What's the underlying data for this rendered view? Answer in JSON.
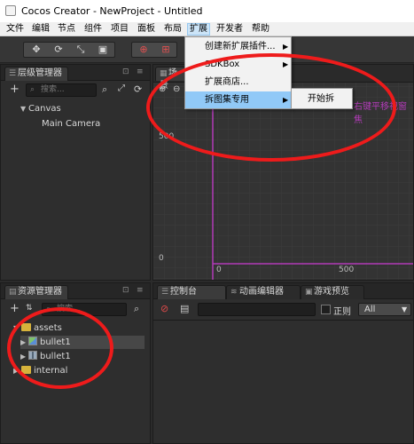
{
  "window": {
    "title": "Cocos Creator - NewProject - Untitled"
  },
  "menubar": {
    "items": [
      "文件",
      "编辑",
      "节点",
      "组件",
      "项目",
      "面板",
      "布局",
      "扩展",
      "开发者",
      "帮助"
    ],
    "active_index": 7
  },
  "toolbar": {
    "transform_tools": [
      "move-tool",
      "rotate-tool",
      "scale-tool",
      "rect-tool"
    ]
  },
  "hierarchy": {
    "tab_label": "层级管理器",
    "search_placeholder": "搜索...",
    "nodes": [
      {
        "label": "Canvas",
        "expanded": true,
        "depth": 0
      },
      {
        "label": "Main Camera",
        "depth": 1
      }
    ]
  },
  "scene": {
    "tab_label": "场景",
    "ruler": {
      "y_labels": [
        "500",
        "0"
      ],
      "x_labels": [
        "0",
        "500"
      ]
    },
    "hint_text": "右键平移视窗焦",
    "colors": {
      "canvas_border": "#b23bb8",
      "background": "#333333",
      "grid": "#3d3d3d"
    }
  },
  "extension_menu": {
    "items": [
      {
        "label": "创建新扩展插件...",
        "has_submenu": true
      },
      {
        "label": "SDKBox",
        "has_submenu": true
      },
      {
        "label": "扩展商店...",
        "has_submenu": false
      },
      {
        "label": "拆图集专用",
        "has_submenu": true,
        "highlighted": true
      }
    ],
    "submenu": {
      "items": [
        "开始拆"
      ]
    }
  },
  "assets": {
    "tab_label": "资源管理器",
    "search_placeholder": "搜索...",
    "items": [
      {
        "label": "assets",
        "type": "folder",
        "expanded": true,
        "depth": 0
      },
      {
        "label": "bullet1",
        "type": "image",
        "depth": 1,
        "selected": true
      },
      {
        "label": "bullet1",
        "type": "atlas",
        "depth": 1
      },
      {
        "label": "internal",
        "type": "folder",
        "depth": 0
      }
    ]
  },
  "bottom_tabs": {
    "tabs": [
      "控制台",
      "动画编辑器",
      "游戏预览"
    ]
  },
  "console": {
    "filter_value": "",
    "regex_label": "正则",
    "level_selected": "All"
  },
  "colors": {
    "annotation_red": "#ee1b1b",
    "menu_highlight": "#91c9f7",
    "folder_yellow": "#d7b33b"
  }
}
